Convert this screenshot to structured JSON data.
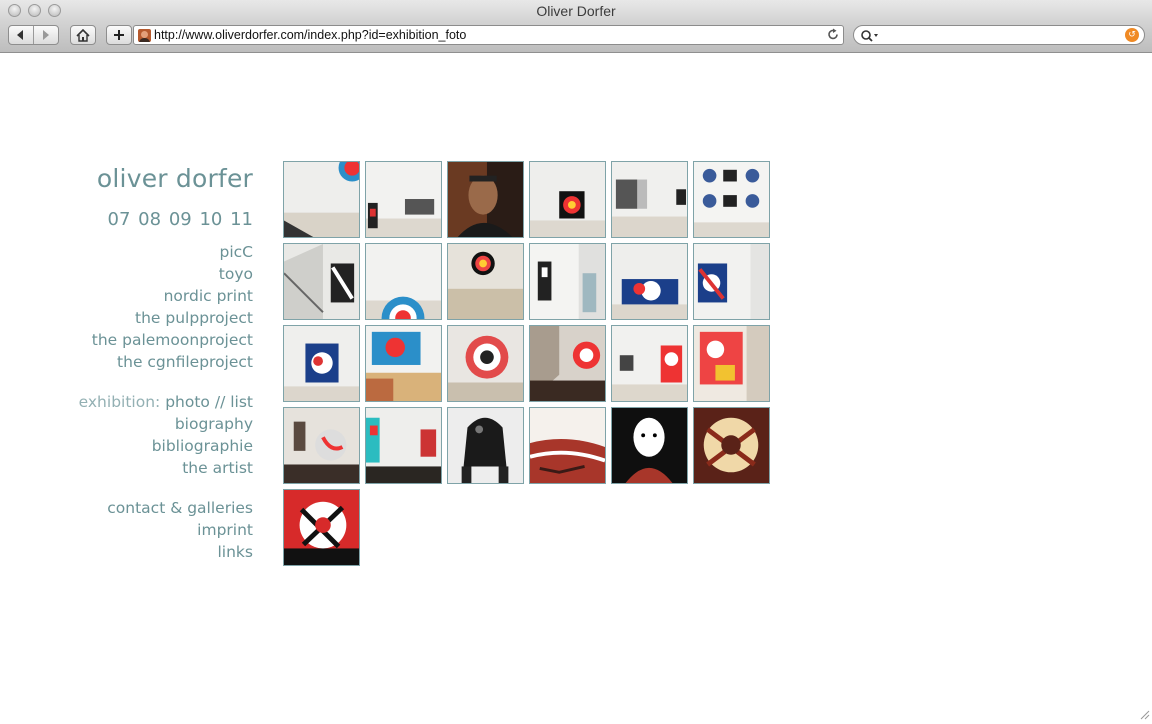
{
  "window": {
    "title": "Oliver Dorfer"
  },
  "toolbar": {
    "url": "http://www.oliverdorfer.com/index.php?id=exhibition_foto",
    "search_value": ""
  },
  "site": {
    "title": "oliver dorfer",
    "years": [
      "07",
      "08",
      "09",
      "10",
      "11"
    ]
  },
  "menu": {
    "projects": [
      "picC",
      "toyo",
      "nordic print",
      "the pulpproject",
      "the palemoonproject",
      "the cgnfileproject"
    ],
    "exhibition_label": "exhibition:",
    "exhibition_photo": "photo",
    "exhibition_sep": "//",
    "exhibition_list": "list",
    "info": [
      "biography",
      "bibliographie",
      "the artist"
    ],
    "contact": [
      "contact & galleries",
      "imprint",
      "links"
    ]
  },
  "gallery": {
    "thumbnail_count": 25,
    "columns": 6
  }
}
